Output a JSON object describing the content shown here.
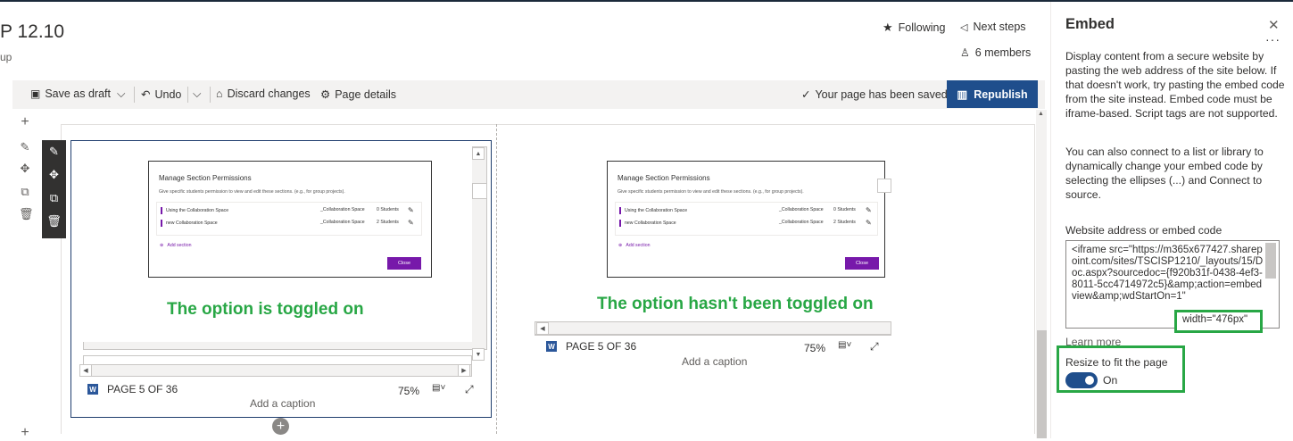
{
  "header": {
    "site_title": "P 12.10",
    "site_subtitle": "up",
    "following_label": "Following",
    "next_steps_label": "Next steps",
    "members_label": "6 members"
  },
  "toolbar": {
    "save_draft_label": "Save as draft",
    "undo_label": "Undo",
    "discard_label": "Discard changes",
    "page_details_label": "Page details",
    "saved_status": "Your page has been saved",
    "republish_label": "Republish"
  },
  "webparts": [
    {
      "dialog_title": "Manage Section Permissions",
      "dialog_text": "Give specific students permission to view and edit these sections. (e.g., for group projects).",
      "rows": [
        {
          "name": "Using the Collaboration Space",
          "space": "_Collaboration Space",
          "count": "0 Students"
        },
        {
          "name": "new Collaboration Space",
          "space": "_Collaboration Space",
          "count": "2 Students"
        }
      ],
      "add_section": "Add section",
      "close_label": "Close",
      "annotation": "The option is toggled on",
      "page_label": "PAGE 5 OF 36",
      "zoom": "75%",
      "caption": "Add a caption"
    },
    {
      "dialog_title": "Manage Section Permissions",
      "dialog_text": "Give specific students permission to view and edit these sections. (e.g., for group projects).",
      "rows": [
        {
          "name": "Using the Collaboration Space",
          "space": "_Collaboration Space",
          "count": "0 Students"
        },
        {
          "name": "new Collaboration Space",
          "space": "_Collaboration Space",
          "count": "2 Students"
        }
      ],
      "add_section": "Add section",
      "close_label": "Close",
      "annotation": "The option hasn't been toggled on",
      "page_label": "PAGE 5 OF 36",
      "zoom": "75%",
      "caption": "Add a caption"
    }
  ],
  "panel": {
    "title": "Embed",
    "description": "Display content from a secure website by pasting the web address of the site below. If that doesn't work, try pasting the embed code from the site instead. Embed code must be iframe-based. Script tags are not supported.",
    "description2": "You can also connect to a list or library to dynamically change your embed code by selecting the ellipses (...) and Connect to source.",
    "field_label": "Website address or embed code",
    "embed_code": "<iframe src=\"https://m365x677427.sharepoint.com/sites/TSCISP1210/_layouts/15/Doc.aspx?sourcedoc={f920b31f-0438-4ef3-8011-5cc4714972c5}&amp;action=embedview&amp;wdStartOn=1\"",
    "width_highlight": "width=\"476px\"",
    "learn_more": "Learn more",
    "resize_label": "Resize to fit the page",
    "toggle_state": "On"
  },
  "colors": {
    "accent": "#1f4e8c",
    "annotation_green": "#28a745",
    "onenote_purple": "#7719aa"
  }
}
